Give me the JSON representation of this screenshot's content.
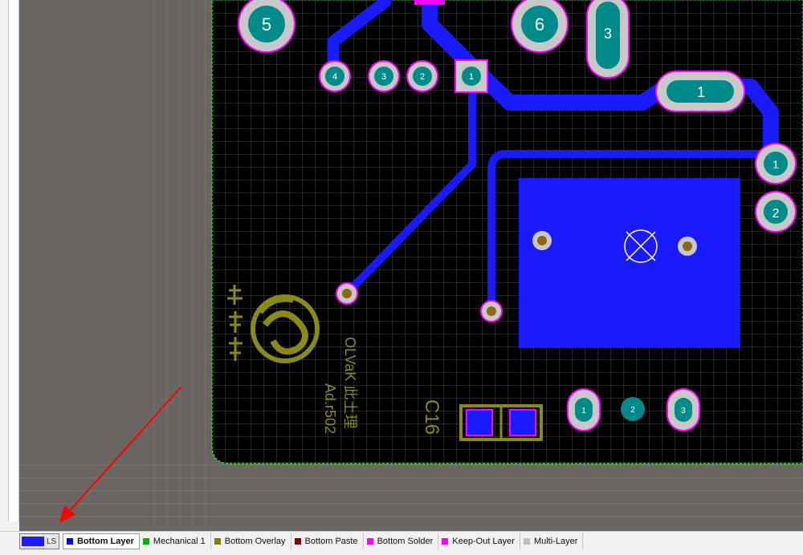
{
  "colors": {
    "workspace_bg": "#6b6562",
    "board_bg": "#000000",
    "grid": "#4a4a4a",
    "bottom_copper": "#1a1aff",
    "pad_teal": "#008b8b",
    "pad_ring_gray": "#c8c8c8",
    "solder_mask_magenta": "#ff00ff",
    "overlay_olive": "#8a8a1a",
    "keepout_green": "#00ff00",
    "arrow_red": "#ff0000"
  },
  "pcb": {
    "pads": [
      {
        "label": "5",
        "kind": "round-large"
      },
      {
        "label": "6",
        "kind": "round-large"
      },
      {
        "label": "3",
        "kind": "oval-vertical"
      },
      {
        "label": "4",
        "kind": "round-small"
      },
      {
        "label": "3",
        "kind": "round-small"
      },
      {
        "label": "2",
        "kind": "round-small"
      },
      {
        "label": "1",
        "kind": "square-small"
      },
      {
        "label": "1",
        "kind": "oval-horizontal"
      },
      {
        "label": "1",
        "kind": "round-medium"
      },
      {
        "label": "2",
        "kind": "round-medium"
      },
      {
        "label": "1",
        "kind": "oval-vertical-small"
      },
      {
        "label": "2",
        "kind": "round-teal"
      },
      {
        "label": "3",
        "kind": "oval-vertical-small"
      }
    ],
    "overlay_text": {
      "board_name": "OLVaK 此土理",
      "version": "Ad.r502",
      "designator": "C16"
    },
    "icons": [
      "logo-icon",
      "via-cross-icon"
    ]
  },
  "layer_bar": {
    "current_swatch_text": "LS",
    "tabs": [
      {
        "label": "Bottom Layer",
        "color": "#0000ff",
        "active": true
      },
      {
        "label": "Mechanical 1",
        "color": "#00b300",
        "active": false
      },
      {
        "label": "Bottom Overlay",
        "color": "#808000",
        "active": false
      },
      {
        "label": "Bottom Paste",
        "color": "#800000",
        "active": false
      },
      {
        "label": "Bottom Solder",
        "color": "#ff00ff",
        "active": false
      },
      {
        "label": "Keep-Out Layer",
        "color": "#ff00ff",
        "active": false
      },
      {
        "label": "Multi-Layer",
        "color": "#c0c0c0",
        "active": false
      }
    ]
  }
}
